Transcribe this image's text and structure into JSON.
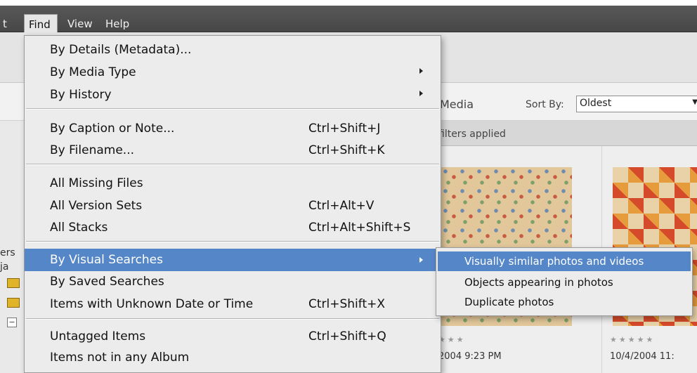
{
  "menubar": {
    "edit_partial": "t",
    "find": "Find",
    "view": "View",
    "help": "Help"
  },
  "find_menu": {
    "items": [
      {
        "label": "By Details (Metadata)...",
        "shortcut": ""
      },
      {
        "label": "By Media Type",
        "shortcut": ""
      },
      {
        "label": "By History",
        "shortcut": ""
      },
      {
        "label": "By Caption or Note...",
        "shortcut": "Ctrl+Shift+J"
      },
      {
        "label": "By Filename...",
        "shortcut": "Ctrl+Shift+K"
      },
      {
        "label": "All Missing Files",
        "shortcut": ""
      },
      {
        "label": "All Version Sets",
        "shortcut": "Ctrl+Alt+V"
      },
      {
        "label": "All Stacks",
        "shortcut": "Ctrl+Alt+Shift+S"
      },
      {
        "label": "By Visual Searches",
        "shortcut": ""
      },
      {
        "label": "By Saved Searches",
        "shortcut": ""
      },
      {
        "label": "Items with Unknown Date or Time",
        "shortcut": "Ctrl+Shift+X"
      },
      {
        "label": "Untagged Items",
        "shortcut": "Ctrl+Shift+Q"
      },
      {
        "label": "Items not in any Album",
        "shortcut": ""
      }
    ]
  },
  "visual_submenu": {
    "items": [
      {
        "label": "Visually similar photos and videos"
      },
      {
        "label": "Objects appearing in photos"
      },
      {
        "label": "Duplicate photos"
      }
    ]
  },
  "background": {
    "media_label": "Media",
    "sort_by_label": "Sort By:",
    "sort_value": "Oldest",
    "filters_text": "filters applied",
    "left_trunc_1": "ers",
    "left_trunc_2": "ja",
    "collapse_symbol": "−",
    "thumb1_stars": "★★★",
    "thumb1_date": "2004 9:23 PM",
    "thumb2_stars": "★★★★★",
    "thumb2_date": "10/4/2004 11:"
  },
  "colors": {
    "menubar": "#474747",
    "highlight": "#5586c8",
    "menu_bg": "#ececec"
  }
}
